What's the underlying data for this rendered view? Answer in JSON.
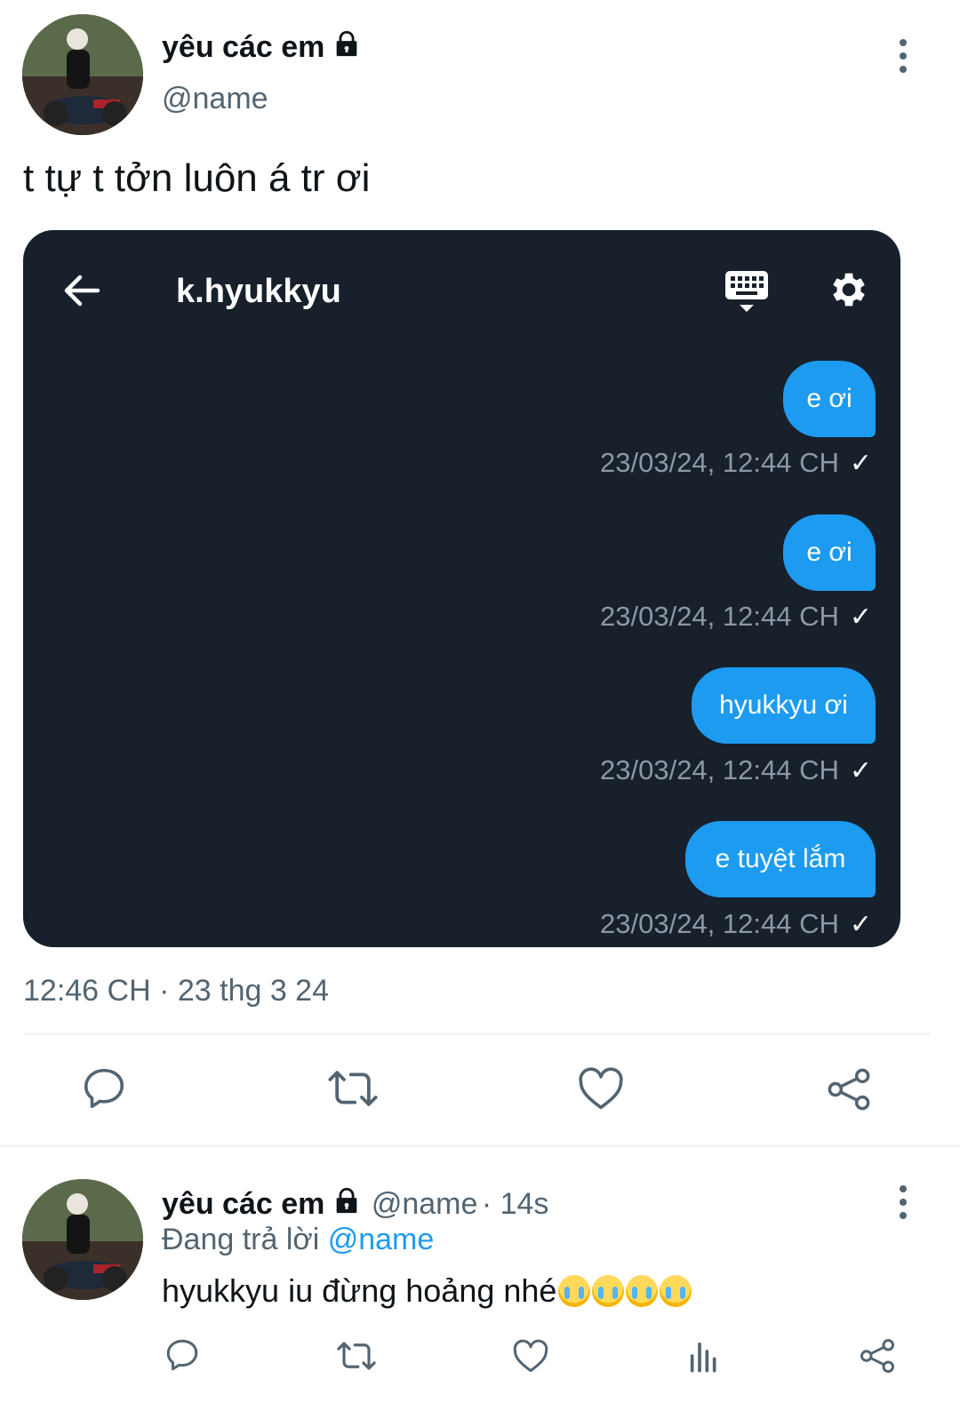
{
  "tweet": {
    "author_name": "yêu các em",
    "author_handle": "@name",
    "text": "t tự t tởn luôn á tr ơi",
    "timestamp": "12:46 CH · 23 thg 3 24"
  },
  "dm": {
    "title": "k.hyukkyu",
    "messages": [
      {
        "text": "e ơi",
        "time": "23/03/24, 12:44 CH"
      },
      {
        "text": "e ơi",
        "time": "23/03/24, 12:44 CH"
      },
      {
        "text": "hyukkyu ơi",
        "time": "23/03/24, 12:44 CH"
      },
      {
        "text": "e tuyệt lắm",
        "time": "23/03/24, 12:44 CH"
      }
    ]
  },
  "reply": {
    "author_name": "yêu các em",
    "author_handle": "@name",
    "time_ago": "· 14s",
    "replying_prefix": "Đang trả lời",
    "replying_mention": "@name",
    "text": "hyukkyu iu đừng hoảng nhé"
  },
  "colors": {
    "accent": "#1d9bf0",
    "dm_background": "#17202b",
    "muted_text": "#536471"
  },
  "icons": [
    "lock-icon",
    "more-icon",
    "back-arrow-icon",
    "keyboard-icon",
    "gear-icon",
    "reply-icon",
    "retweet-icon",
    "like-icon",
    "share-icon",
    "analytics-icon",
    "crying-emoji"
  ]
}
